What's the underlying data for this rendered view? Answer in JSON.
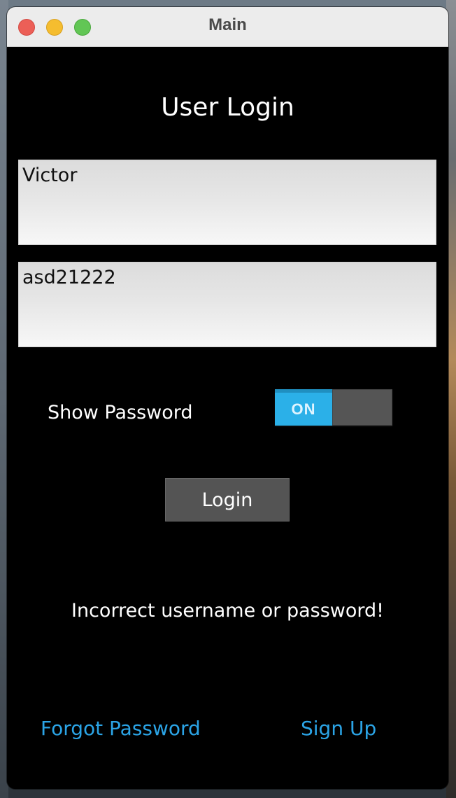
{
  "window": {
    "title": "Main"
  },
  "login": {
    "heading": "User Login",
    "username_value": "Victor",
    "password_value": "asd21222",
    "show_password_label": "Show Password",
    "show_password_toggle": "ON",
    "login_button": "Login",
    "error_message": "Incorrect username or password!",
    "forgot_password_link": "Forgot Password",
    "sign_up_link": "Sign Up"
  },
  "colors": {
    "toggle_on": "#2bb0e8",
    "link": "#2ba4e6",
    "background": "#000000",
    "button": "#545454"
  }
}
